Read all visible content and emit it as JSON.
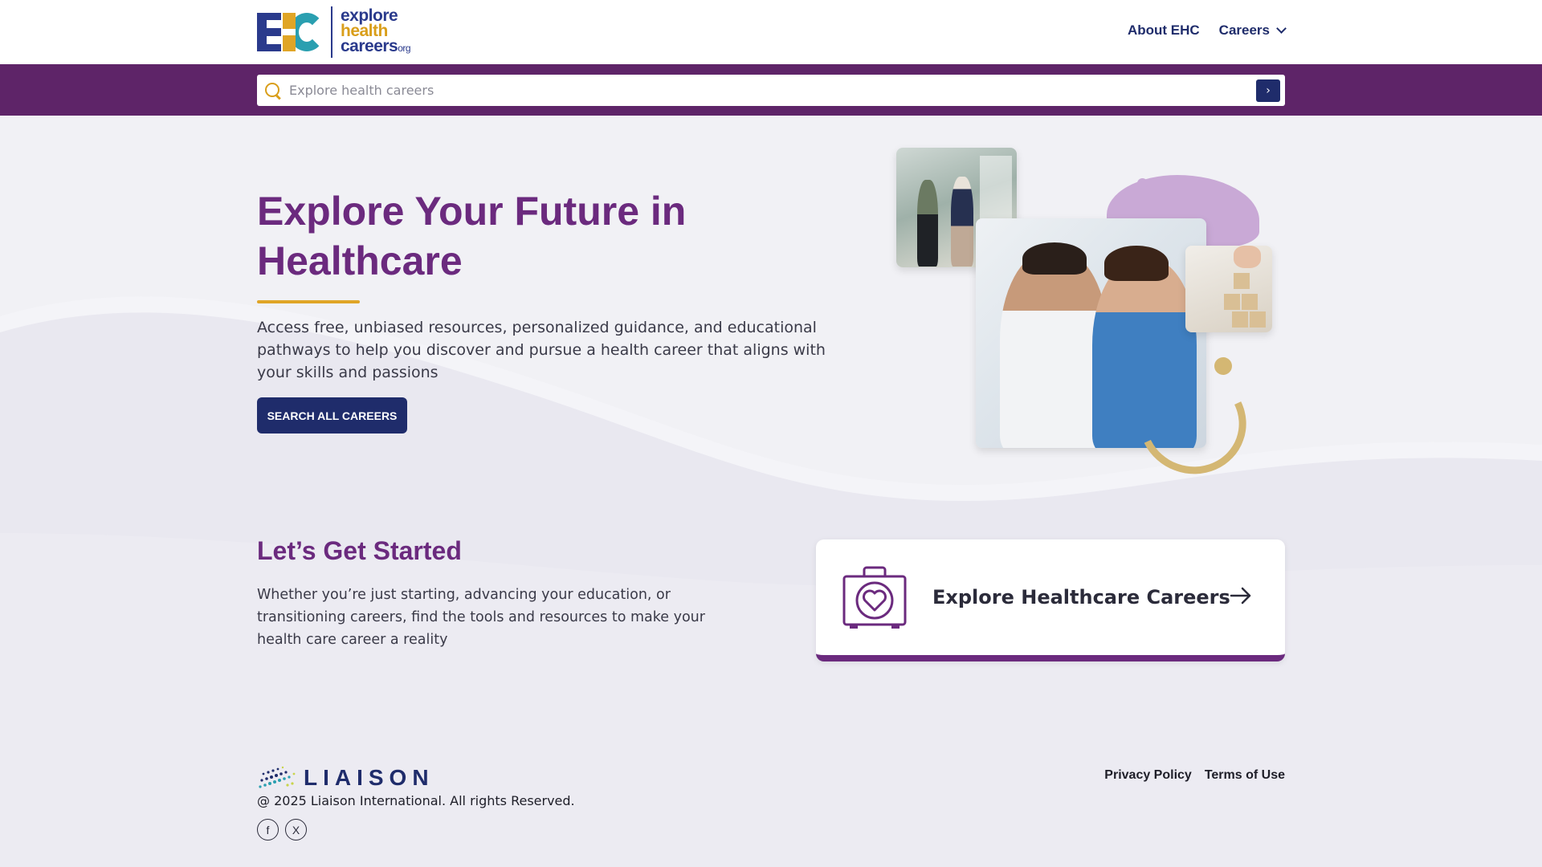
{
  "logo": {
    "line1": "explore",
    "line2": "health",
    "line3": "careers",
    "suffix": "org"
  },
  "nav": {
    "about_label": "About EHC",
    "careers_label": "Careers"
  },
  "search": {
    "placeholder": "Explore health careers",
    "go_label": "›"
  },
  "hero": {
    "title": "Explore Your Future in Healthcare",
    "description": "Access free, unbiased resources, personalized guidance, and educational pathways to help you discover and pursue a health career that aligns with your skills and passions",
    "button_label": "SEARCH ALL CAREERS"
  },
  "started": {
    "title": "Let’s Get Started",
    "description": "Whether you’re just starting, advancing your education, or transitioning careers, find the tools and resources to make your health care career a reality",
    "card_label": "Explore Healthcare Careers"
  },
  "footer": {
    "brand": "LIAISON",
    "copyright": "@ 2025 Liaison International. All rights Reserved.",
    "social": [
      {
        "icon": "facebook-icon",
        "glyph": "f"
      },
      {
        "icon": "x-twitter-icon",
        "glyph": "X"
      }
    ],
    "links": [
      "Privacy Policy",
      "Terms of Use"
    ]
  },
  "colors": {
    "brand_purple": "#6b2a7e",
    "band_purple": "#5e2468",
    "navy": "#1f2c6b",
    "gold": "#e0a526",
    "background": "#f1f1f5"
  }
}
